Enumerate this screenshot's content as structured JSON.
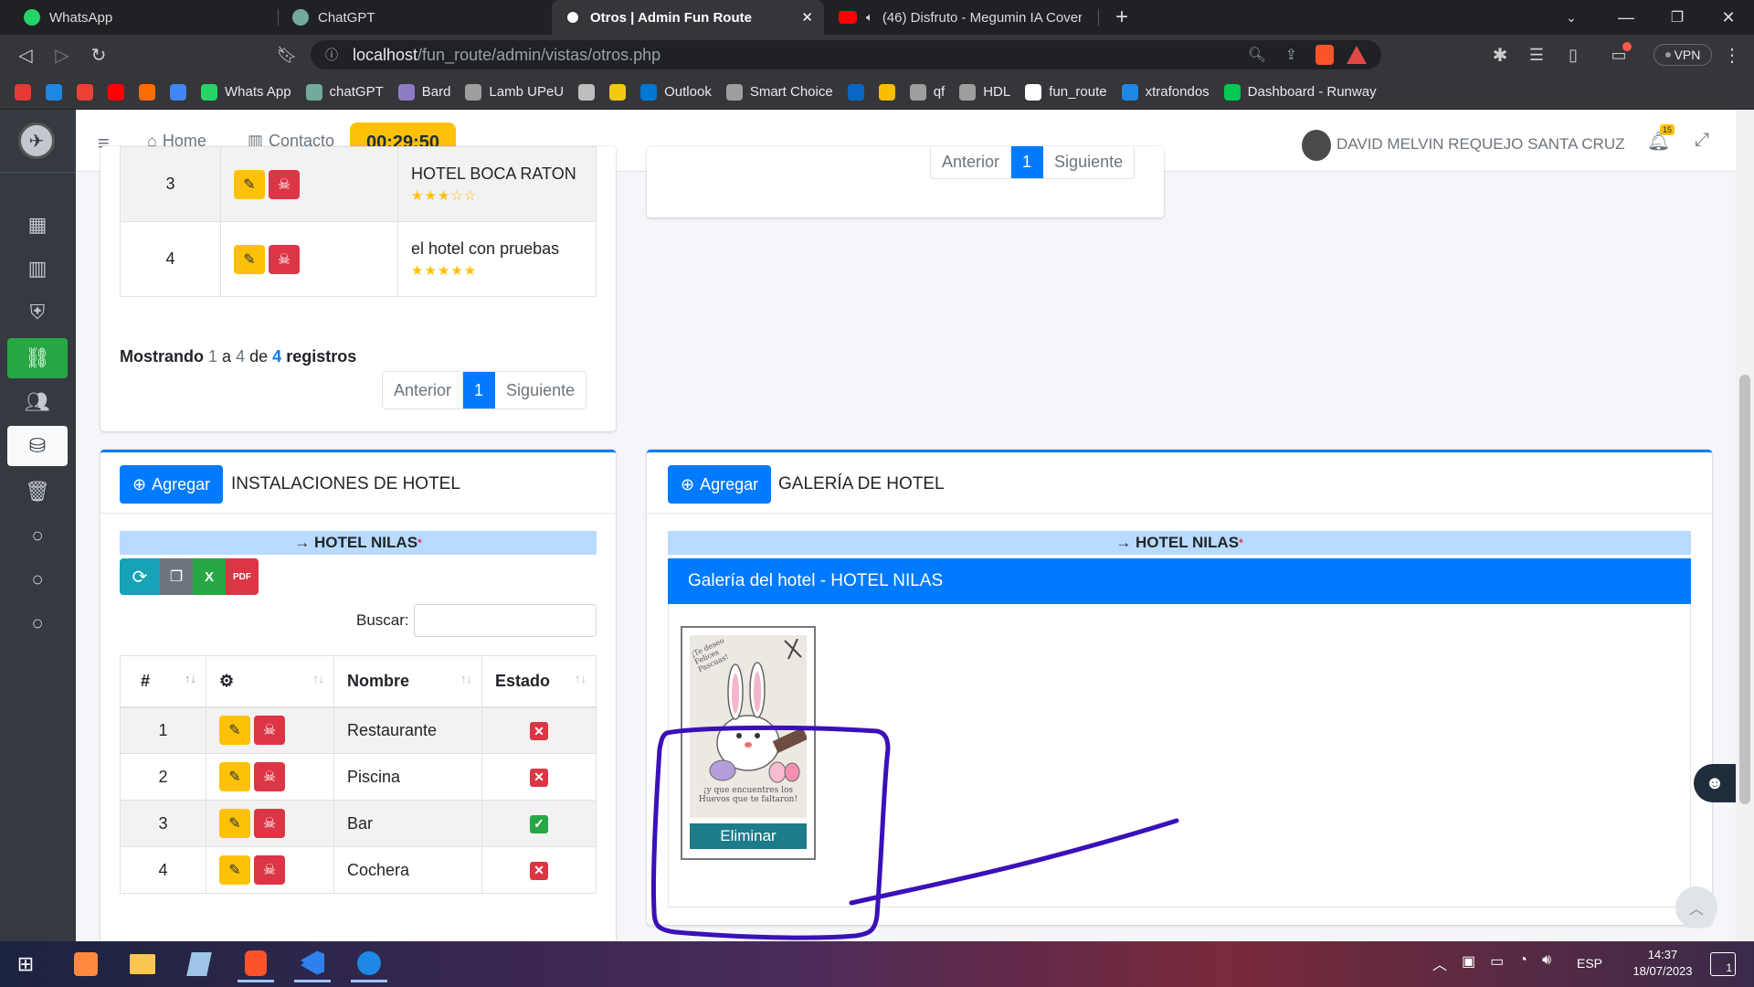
{
  "tabs": [
    {
      "label": "WhatsApp",
      "icon": "whatsapp-icon"
    },
    {
      "label": "ChatGPT",
      "icon": "chatgpt-icon"
    },
    {
      "label": "Otros | Admin Fun Route",
      "icon": "fun-route-icon"
    },
    {
      "label": "(46) Disfruto - Megumin IA Cover",
      "icon": "youtube-icon"
    }
  ],
  "address": {
    "host": "localhost",
    "path": "/fun_route/admin/vistas/otros.php",
    "vpn": "VPN"
  },
  "bookmarks": [
    {
      "label": "",
      "icon": "sy-icon",
      "color": "#e53935"
    },
    {
      "label": "",
      "icon": "edge-icon",
      "color": "#1e88e5"
    },
    {
      "label": "",
      "icon": "gmail-icon",
      "color": "#ea4335"
    },
    {
      "label": "",
      "icon": "youtube-icon",
      "color": "#ff0000"
    },
    {
      "label": "",
      "icon": "html5-icon",
      "color": "#ff6d00"
    },
    {
      "label": "",
      "icon": "translate-icon",
      "color": "#4285f4"
    },
    {
      "label": "Whats App",
      "icon": "whatsapp-icon",
      "color": "#25d366"
    },
    {
      "label": "chatGPT",
      "icon": "chatgpt-icon",
      "color": "#74aa9c"
    },
    {
      "label": "Bard",
      "icon": "bard-icon",
      "color": "#8e7cc3"
    },
    {
      "label": "Lamb UPeU",
      "icon": "globe-icon",
      "color": "#9e9e9e"
    },
    {
      "label": "",
      "icon": "trophy-icon",
      "color": "#bdbdbd"
    },
    {
      "label": "",
      "icon": "powerbi-icon",
      "color": "#f2c811"
    },
    {
      "label": "Outlook",
      "icon": "outlook-icon",
      "color": "#0078d4"
    },
    {
      "label": "Smart Choice",
      "icon": "globe-icon",
      "color": "#9e9e9e"
    },
    {
      "label": "",
      "icon": "onedrive-icon",
      "color": "#0a66c2"
    },
    {
      "label": "",
      "icon": "keep-icon",
      "color": "#fbbc04"
    },
    {
      "label": "qf",
      "icon": "layers-icon",
      "color": "#9e9e9e"
    },
    {
      "label": "HDL",
      "icon": "globe-icon",
      "color": "#9e9e9e"
    },
    {
      "label": "fun_route",
      "icon": "github-icon",
      "color": "#ffffff"
    },
    {
      "label": "xtrafondos",
      "icon": "eye-icon",
      "color": "#1e88e5"
    },
    {
      "label": "Dashboard - Runway",
      "icon": "runway-icon",
      "color": "#00c853"
    }
  ],
  "topnav": {
    "home": "Home",
    "contact": "Contacto",
    "timer": "00:29:50",
    "user": "DAVID MELVIN REQUEJO SANTA CRUZ",
    "notif_count": "15"
  },
  "hotels_card": {
    "rows": [
      {
        "num": "3",
        "name": "HOTEL BOCA RATON",
        "stars": "★★★☆☆"
      },
      {
        "num": "4",
        "name": "el hotel con pruebas",
        "stars": "★★★★★"
      }
    ],
    "showing_prefix": "Mostrando",
    "showing_from": "1",
    "showing_a": "a",
    "showing_to": "4",
    "showing_de": "de",
    "showing_total": "4",
    "showing_suffix": "registros",
    "prev": "Anterior",
    "page": "1",
    "next": "Siguiente"
  },
  "top_right_pager": {
    "prev": "Anterior",
    "page": "1",
    "next": "Siguiente"
  },
  "facilities_card": {
    "add": "Agregar",
    "title": "INSTALACIONES DE HOTEL",
    "hotel": "→ HOTEL NILAS",
    "required": "*",
    "search_label": "Buscar:",
    "columns": [
      "#",
      "",
      "Nombre",
      "Estado"
    ],
    "rows": [
      {
        "num": "1",
        "name": "Restaurante",
        "estado": "no"
      },
      {
        "num": "2",
        "name": "Piscina",
        "estado": "no"
      },
      {
        "num": "3",
        "name": "Bar",
        "estado": "si"
      },
      {
        "num": "4",
        "name": "Cochera",
        "estado": "no"
      }
    ]
  },
  "gallery_card": {
    "add": "Agregar",
    "title": "GALERÍA DE HOTEL",
    "hotel": "→ HOTEL NILAS",
    "required": "*",
    "header": "Galería del hotel - HOTEL NILAS",
    "delete": "Eliminar",
    "photo_text_top": "¡Te deseo Felices Pascuas!",
    "photo_text_bottom": "¡y que encuentres los Huevos que te faltaron!"
  },
  "taskbar": {
    "lang": "ESP",
    "time": "14:37",
    "date": "18/07/2023",
    "notif": "1"
  },
  "colors": {
    "primary": "#007bff",
    "warning": "#ffc107",
    "danger": "#dc3545",
    "success": "#28a745",
    "annotation": "#3a10b8"
  }
}
